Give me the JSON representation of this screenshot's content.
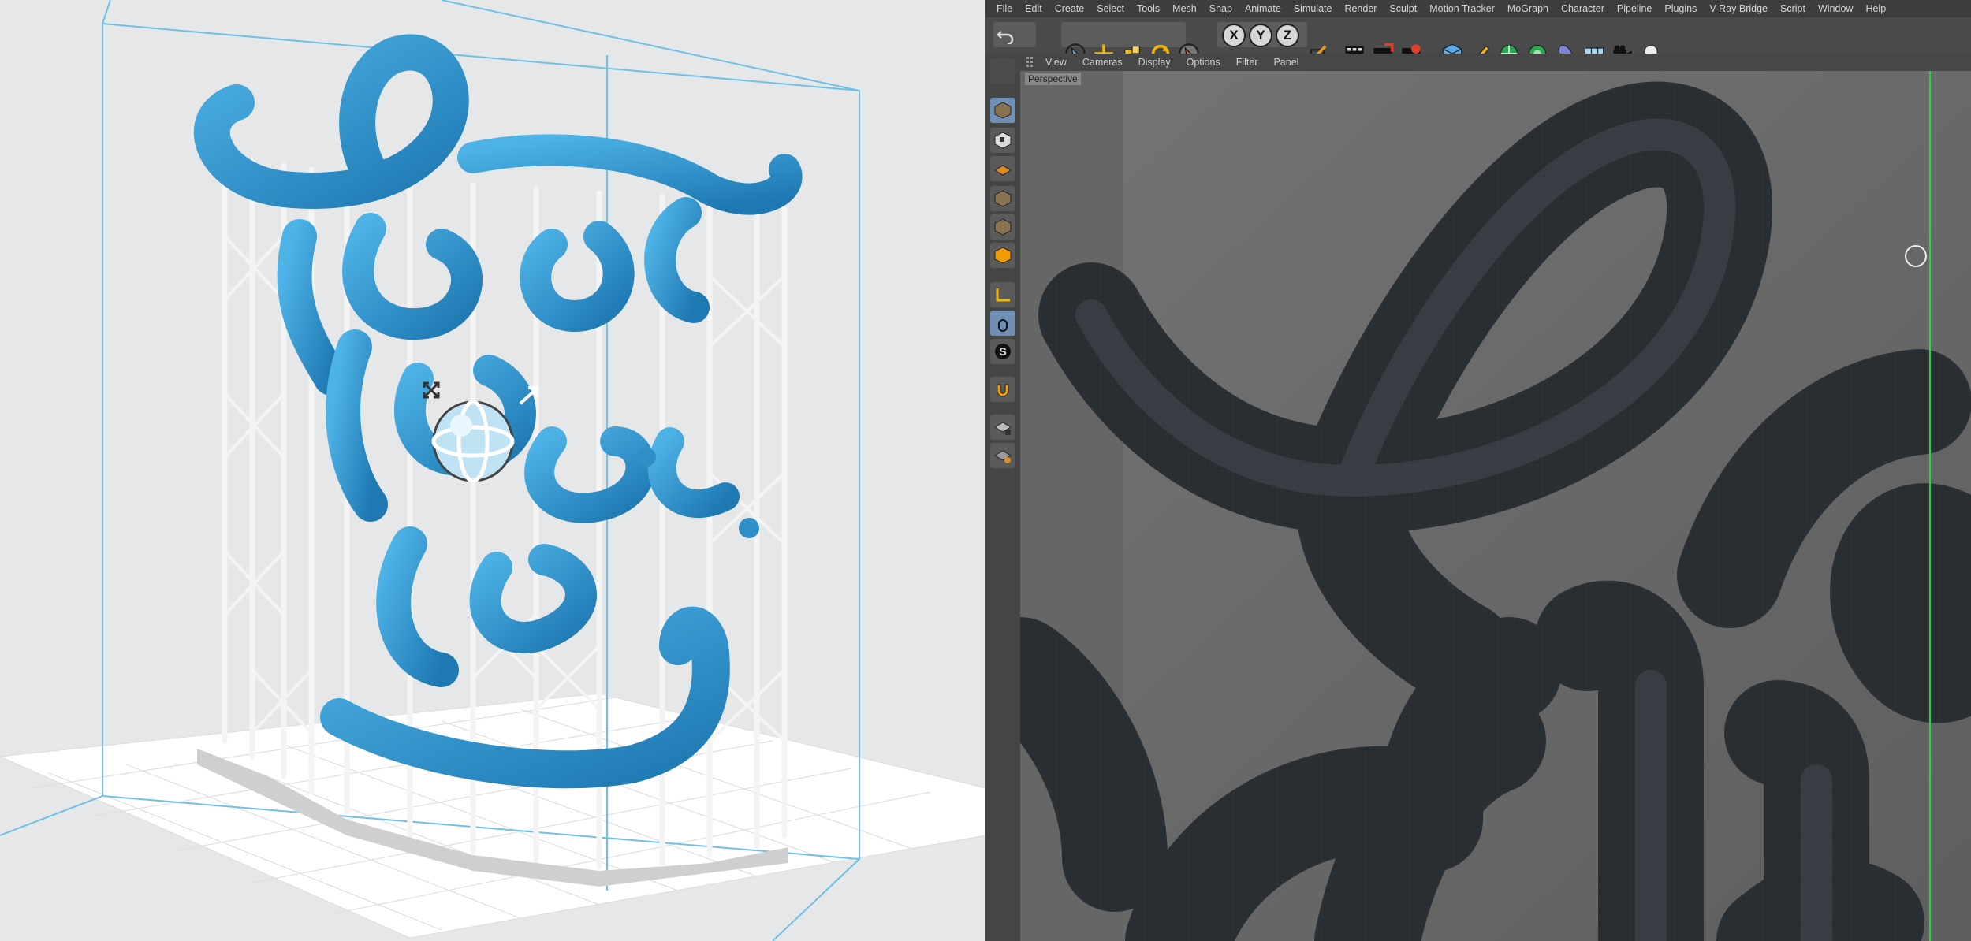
{
  "menu": [
    "File",
    "Edit",
    "Create",
    "Select",
    "Tools",
    "Mesh",
    "Snap",
    "Animate",
    "Simulate",
    "Render",
    "Sculpt",
    "Motion Tracker",
    "MoGraph",
    "Character",
    "Pipeline",
    "Plugins",
    "V-Ray Bridge",
    "Script",
    "Window",
    "Help"
  ],
  "toolbar": {
    "axis_x": "X",
    "axis_y": "Y",
    "axis_z": "Z",
    "icons": [
      "undo-icon",
      "redo-icon",
      "live-select-icon",
      "move-icon",
      "scale-icon",
      "rotate-icon",
      "recent-tool-icon",
      "x-axis-icon",
      "y-axis-icon",
      "z-axis-icon",
      "coordinate-system-icon",
      "render-view-icon",
      "render-picture-viewer-icon",
      "edit-render-settings-icon",
      "cube-icon",
      "pen-icon",
      "subdivision-icon",
      "array-icon",
      "deformer-icon",
      "floor-icon",
      "camera-icon",
      "light-icon"
    ]
  },
  "side_tools": [
    "make-editable-icon",
    "model-mode-icon",
    "texture-mode-icon",
    "workplane-icon",
    "points-mode-icon",
    "edges-mode-icon",
    "polygons-mode-icon",
    "axis-icon",
    "tweak-icon",
    "solo-icon",
    "snap-icon",
    "lock-workplane-icon",
    "workplane-grid-icon"
  ],
  "viewport_menu": [
    "View",
    "Cameras",
    "Display",
    "Options",
    "Filter",
    "Panel"
  ],
  "viewport": {
    "camera": "Perspective"
  },
  "colors": {
    "model": "#2f8fc6",
    "supports": "#f2f2f2",
    "build_volume": "#6ec0e6",
    "mesh": "#3c4248"
  }
}
